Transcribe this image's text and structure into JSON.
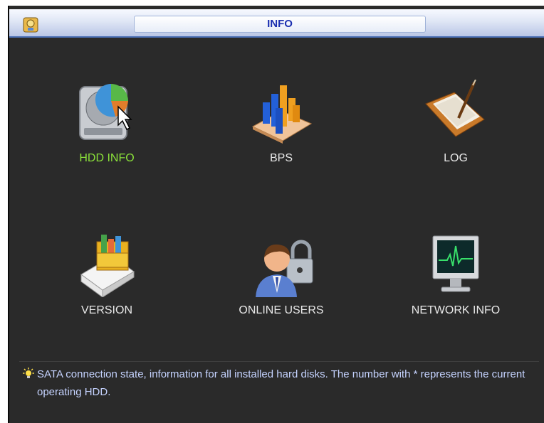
{
  "window": {
    "title": "INFO"
  },
  "menu": {
    "items": [
      {
        "label": "HDD INFO",
        "icon": "hdd-pie-icon",
        "selected": true
      },
      {
        "label": "BPS",
        "icon": "bar-chart-icon",
        "selected": false
      },
      {
        "label": "LOG",
        "icon": "log-book-icon",
        "selected": false
      },
      {
        "label": "VERSION",
        "icon": "version-box-icon",
        "selected": false
      },
      {
        "label": "ONLINE USERS",
        "icon": "user-lock-icon",
        "selected": false
      },
      {
        "label": "NETWORK INFO",
        "icon": "network-monitor-icon",
        "selected": false
      }
    ]
  },
  "hint": {
    "icon": "lightbulb-icon",
    "text": "SATA connection state, information for all installed hard disks. The number with * represents the current operating HDD."
  },
  "colors": {
    "selected_label": "#8be23a",
    "label": "#e8e8e8",
    "hint_text": "#c5d3ff",
    "title_text": "#1a2fb0",
    "background": "#2a2a2a"
  }
}
